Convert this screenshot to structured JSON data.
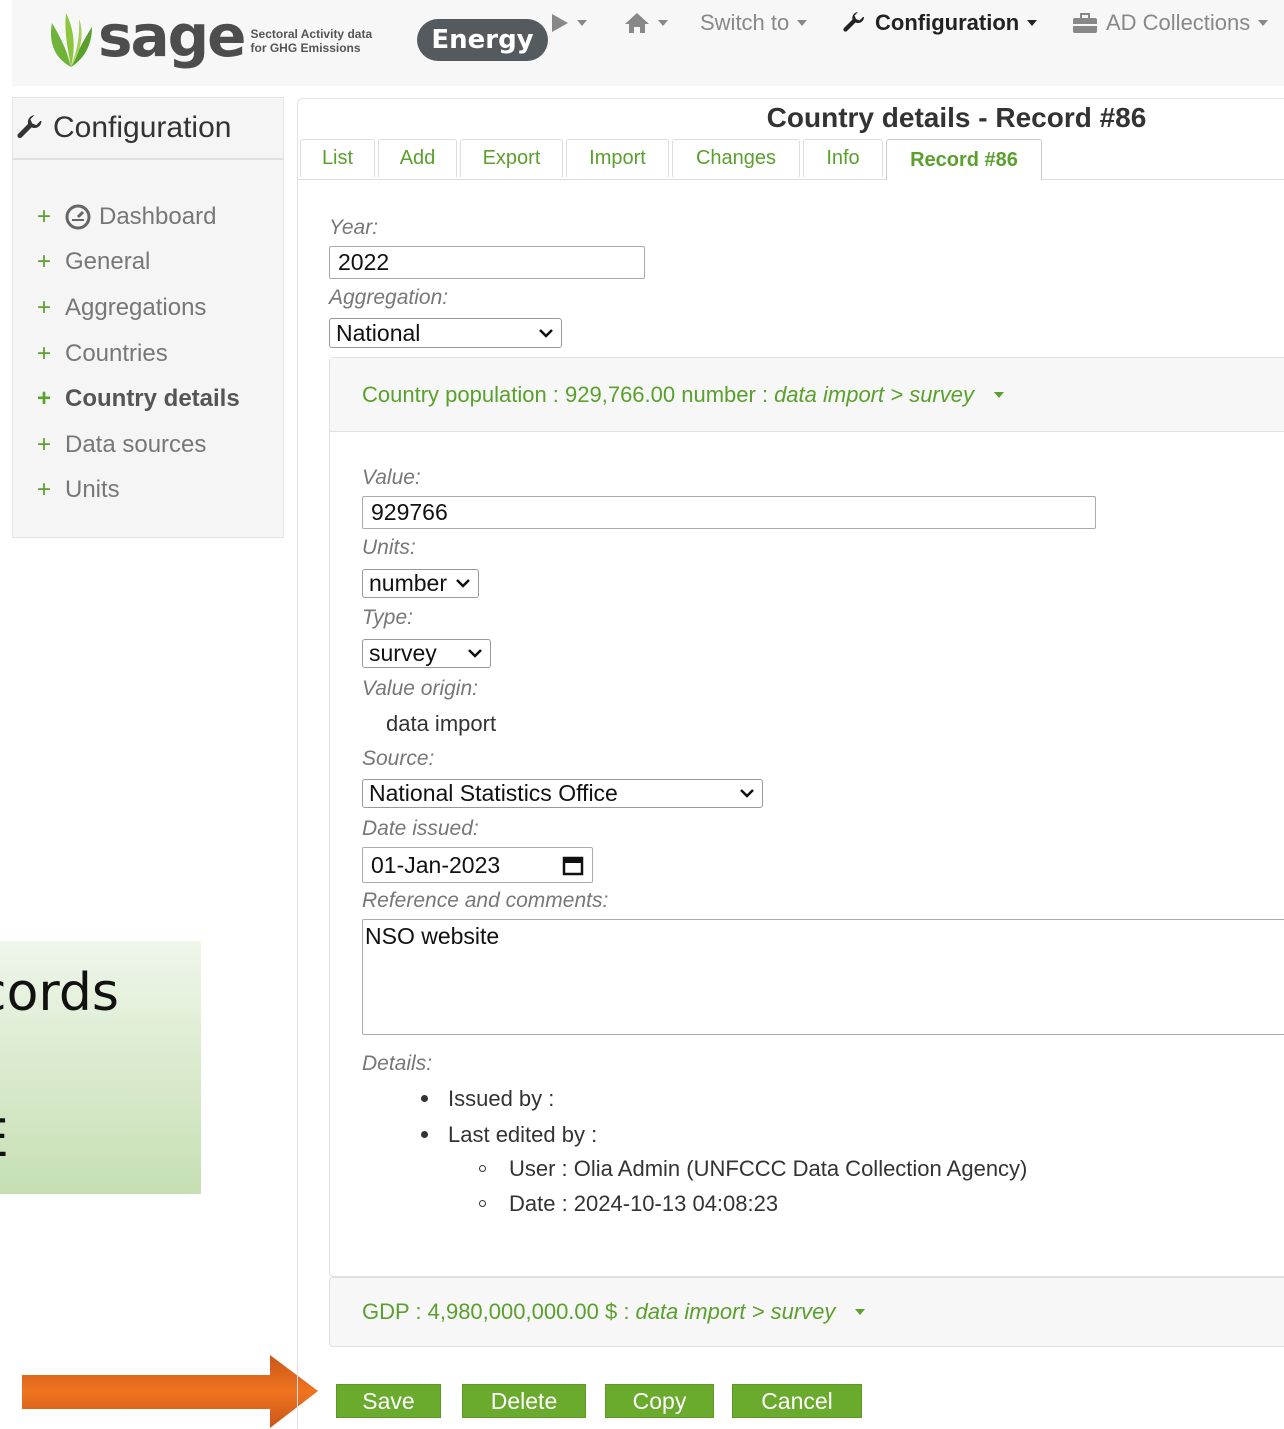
{
  "app": {
    "logo_text": "sage",
    "logo_subtitle_1": "Sectoral Activity data",
    "logo_subtitle_2": "for GHG Emissions",
    "module_badge": "Energy"
  },
  "topnav": {
    "switch_to": "Switch to",
    "configuration": "Configuration",
    "ad_collections": "AD Collections"
  },
  "sidebar": {
    "title": "Configuration",
    "items": [
      {
        "label": "Dashboard"
      },
      {
        "label": "General"
      },
      {
        "label": "Aggregations"
      },
      {
        "label": "Countries"
      },
      {
        "label": "Country details"
      },
      {
        "label": "Data sources"
      },
      {
        "label": "Units"
      }
    ]
  },
  "slide": {
    "fragment_1": "cords",
    "fragment_2": "E"
  },
  "page": {
    "title": "Country details - Record #86",
    "tabs": [
      "List",
      "Add",
      "Export",
      "Import",
      "Changes",
      "Info",
      "Record #86"
    ],
    "active_tab": "Record #86"
  },
  "form": {
    "year_label": "Year:",
    "year_value": "2022",
    "aggregation_label": "Aggregation:",
    "aggregation_value": "National",
    "record1": {
      "header_prefix": "Country population : 929,766.00 number :",
      "header_origin": "data import > survey",
      "value_label": "Value:",
      "value": "929766",
      "units_label": "Units:",
      "units_value": "number",
      "type_label": "Type:",
      "type_value": "survey",
      "origin_label": "Value origin:",
      "origin_value": "data import",
      "source_label": "Source:",
      "source_value": "National Statistics Office",
      "date_label": "Date issued:",
      "date_value": "01-Jan-2023",
      "comments_label": "Reference and comments:",
      "comments_value": "NSO website",
      "details_label": "Details:",
      "issued_by": "Issued by :",
      "last_edited_by": "Last edited by :",
      "edited_user": "User : Olia Admin (UNFCCC Data Collection Agency)",
      "edited_date": "Date : 2024-10-13 04:08:23"
    },
    "record2": {
      "header_prefix": "GDP : 4,980,000,000.00 $ :",
      "header_origin": "data import > survey"
    }
  },
  "buttons": {
    "save": "Save",
    "delete": "Delete",
    "copy": "Copy",
    "cancel": "Cancel"
  },
  "colors": {
    "accent_green": "#5aa02c",
    "button_green": "#6aaa2c",
    "badge_gray": "#555a5e",
    "arrow_orange": "#e8641c"
  }
}
